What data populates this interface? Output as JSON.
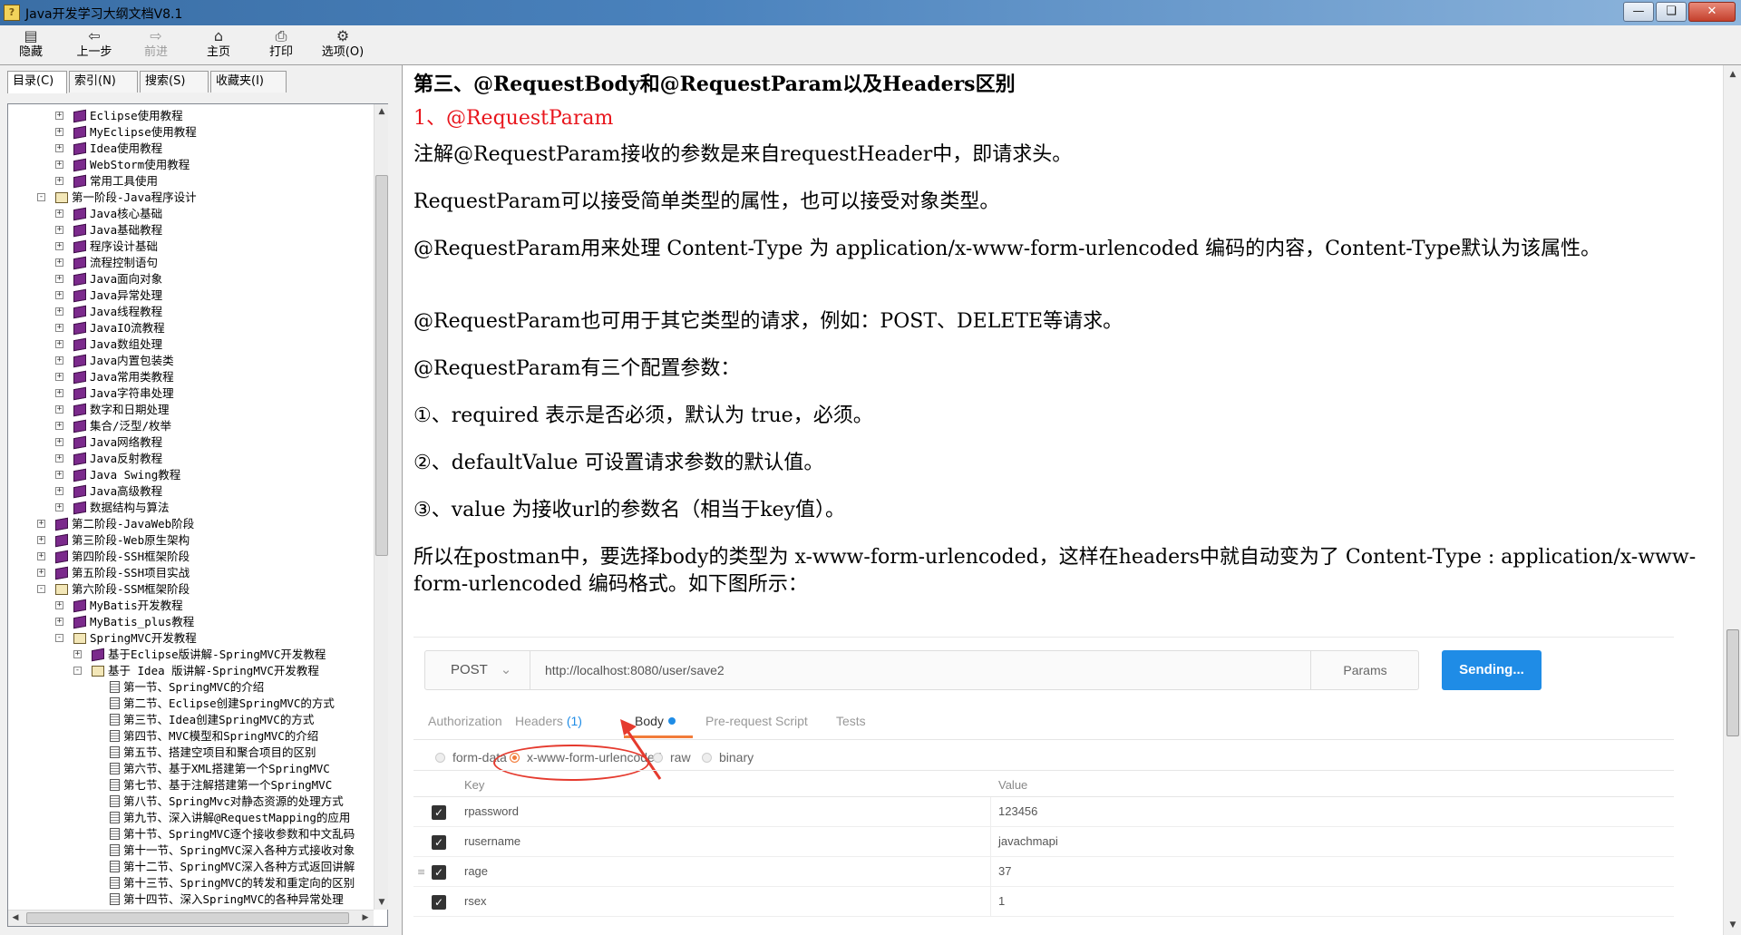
{
  "window": {
    "title": "Java开发学习大纲文档V8.1",
    "app_icon": "?"
  },
  "toolbar": {
    "hide": "隐藏",
    "back": "上一步",
    "forward": "前进",
    "home": "主页",
    "print": "打印",
    "options": "选项(O)"
  },
  "nav_tabs": [
    "目录(C)",
    "索引(N)",
    "搜索(S)",
    "收藏夹(I)"
  ],
  "tree": [
    {
      "label": "Eclipse使用教程",
      "level": 1,
      "icon": "book",
      "toggle": "+"
    },
    {
      "label": "MyEclipse使用教程",
      "level": 1,
      "icon": "book",
      "toggle": "+"
    },
    {
      "label": "Idea使用教程",
      "level": 1,
      "icon": "book",
      "toggle": "+"
    },
    {
      "label": "WebStorm使用教程",
      "level": 1,
      "icon": "book",
      "toggle": "+"
    },
    {
      "label": "常用工具使用",
      "level": 1,
      "icon": "book",
      "toggle": "+"
    },
    {
      "label": "第一阶段-Java程序设计",
      "level": 0,
      "icon": "book-open",
      "toggle": "-"
    },
    {
      "label": "Java核心基础",
      "level": 1,
      "icon": "book",
      "toggle": "+"
    },
    {
      "label": "Java基础教程",
      "level": 1,
      "icon": "book",
      "toggle": "+"
    },
    {
      "label": "程序设计基础",
      "level": 1,
      "icon": "book",
      "toggle": "+"
    },
    {
      "label": "流程控制语句",
      "level": 1,
      "icon": "book",
      "toggle": "+"
    },
    {
      "label": "Java面向对象",
      "level": 1,
      "icon": "book",
      "toggle": "+"
    },
    {
      "label": "Java异常处理",
      "level": 1,
      "icon": "book",
      "toggle": "+"
    },
    {
      "label": "Java线程教程",
      "level": 1,
      "icon": "book",
      "toggle": "+"
    },
    {
      "label": "JavaIO流教程",
      "level": 1,
      "icon": "book",
      "toggle": "+"
    },
    {
      "label": "Java数组处理",
      "level": 1,
      "icon": "book",
      "toggle": "+"
    },
    {
      "label": "Java内置包装类",
      "level": 1,
      "icon": "book",
      "toggle": "+"
    },
    {
      "label": "Java常用类教程",
      "level": 1,
      "icon": "book",
      "toggle": "+"
    },
    {
      "label": "Java字符串处理",
      "level": 1,
      "icon": "book",
      "toggle": "+"
    },
    {
      "label": "数字和日期处理",
      "level": 1,
      "icon": "book",
      "toggle": "+"
    },
    {
      "label": "集合/泛型/枚举",
      "level": 1,
      "icon": "book",
      "toggle": "+"
    },
    {
      "label": "Java网络教程",
      "level": 1,
      "icon": "book",
      "toggle": "+"
    },
    {
      "label": "Java反射教程",
      "level": 1,
      "icon": "book",
      "toggle": "+"
    },
    {
      "label": "Java Swing教程",
      "level": 1,
      "icon": "book",
      "toggle": "+"
    },
    {
      "label": "Java高级教程",
      "level": 1,
      "icon": "book",
      "toggle": "+"
    },
    {
      "label": "数据结构与算法",
      "level": 1,
      "icon": "book",
      "toggle": "+"
    },
    {
      "label": "第二阶段-JavaWeb阶段",
      "level": 0,
      "icon": "book",
      "toggle": "+"
    },
    {
      "label": "第三阶段-Web原生架构",
      "level": 0,
      "icon": "book",
      "toggle": "+"
    },
    {
      "label": "第四阶段-SSH框架阶段",
      "level": 0,
      "icon": "book",
      "toggle": "+"
    },
    {
      "label": "第五阶段-SSH项目实战",
      "level": 0,
      "icon": "book",
      "toggle": "+"
    },
    {
      "label": "第六阶段-SSM框架阶段",
      "level": 0,
      "icon": "book-open",
      "toggle": "-"
    },
    {
      "label": "MyBatis开发教程",
      "level": 1,
      "icon": "book",
      "toggle": "+"
    },
    {
      "label": "MyBatis_plus教程",
      "level": 1,
      "icon": "book",
      "toggle": "+"
    },
    {
      "label": "SpringMVC开发教程",
      "level": 1,
      "icon": "book-open",
      "toggle": "-"
    },
    {
      "label": "基于Eclipse版讲解-SpringMVC开发教程",
      "level": 2,
      "icon": "book",
      "toggle": "+"
    },
    {
      "label": "基于  Idea 版讲解-SpringMVC开发教程",
      "level": 2,
      "icon": "book-open",
      "toggle": "-"
    },
    {
      "label": "第一节、SpringMVC的介绍",
      "level": 3,
      "icon": "page",
      "toggle": ""
    },
    {
      "label": "第二节、Eclipse创建SpringMVC的方式",
      "level": 3,
      "icon": "page",
      "toggle": ""
    },
    {
      "label": "第三节、Idea创建SpringMVC的方式",
      "level": 3,
      "icon": "page",
      "toggle": ""
    },
    {
      "label": "第四节、MVC模型和SpringMVC的介绍",
      "level": 3,
      "icon": "page",
      "toggle": ""
    },
    {
      "label": "第五节、搭建空项目和聚合项目的区别",
      "level": 3,
      "icon": "page",
      "toggle": ""
    },
    {
      "label": "第六节、基于XML搭建第一个SpringMVC",
      "level": 3,
      "icon": "page",
      "toggle": ""
    },
    {
      "label": "第七节、基于注解搭建第一个SpringMVC",
      "level": 3,
      "icon": "page",
      "toggle": ""
    },
    {
      "label": "第八节、SpringMvc对静态资源的处理方式",
      "level": 3,
      "icon": "page",
      "toggle": ""
    },
    {
      "label": "第九节、深入讲解@RequestMapping的应用",
      "level": 3,
      "icon": "page",
      "toggle": ""
    },
    {
      "label": "第十节、SpringMVC逐个接收参数和中文乱码",
      "level": 3,
      "icon": "page",
      "toggle": ""
    },
    {
      "label": "第十一节、SpringMVC深入各种方式接收对象",
      "level": 3,
      "icon": "page",
      "toggle": ""
    },
    {
      "label": "第十二节、SpringMVC深入各种方式返回讲解",
      "level": 3,
      "icon": "page",
      "toggle": ""
    },
    {
      "label": "第十三节、SpringMVC的转发和重定向的区别",
      "level": 3,
      "icon": "page",
      "toggle": ""
    },
    {
      "label": "第十四节、深入SpringMVC的各种异常处理",
      "level": 3,
      "icon": "page",
      "toggle": ""
    }
  ],
  "article": {
    "heading": "第三、@RequestBody和@RequestParam以及Headers区别",
    "subheading": "1、@RequestParam",
    "paragraphs": [
      "注解@RequestParam接收的参数是来自requestHeader中，即请求头。",
      "RequestParam可以接受简单类型的属性，也可以接受对象类型。",
      "@RequestParam用来处理 Content-Type 为 application/x-www-form-urlencoded 编码的内容，Content-Type默认为该属性。",
      "@RequestParam也可用于其它类型的请求，例如：POST、DELETE等请求。",
      "@RequestParam有三个配置参数：",
      "①、required 表示是否必须，默认为 true，必须。",
      "②、defaultValue 可设置请求参数的默认值。",
      "③、value 为接收url的参数名（相当于key值）。",
      "所以在postman中，要选择body的类型为 x-www-form-urlencoded，这样在headers中就自动变为了 Content-Type : application/x-www-form-urlencoded 编码格式。如下图所示："
    ]
  },
  "postman": {
    "method": "POST",
    "url": "http://localhost:8080/user/save2",
    "params_label": "Params",
    "send_label": "Sending...",
    "tabs": {
      "authorization": "Authorization",
      "headers": "Headers",
      "headers_count": "(1)",
      "body": "Body",
      "prerequest": "Pre-request Script",
      "tests": "Tests"
    },
    "body_types": [
      "form-data",
      "x-www-form-urlencoded",
      "raw",
      "binary"
    ],
    "selected_body_type": "x-www-form-urlencoded",
    "columns": {
      "key": "Key",
      "value": "Value"
    },
    "rows": [
      {
        "key": "rpassword",
        "value": "123456"
      },
      {
        "key": "rusername",
        "value": "javachmapi"
      },
      {
        "key": "rage",
        "value": "37"
      },
      {
        "key": "rsex",
        "value": "1"
      }
    ],
    "accent_color": "#1f8ce6",
    "tab_underline_color": "#f27c3a",
    "annotation_color": "#e53a2e"
  }
}
